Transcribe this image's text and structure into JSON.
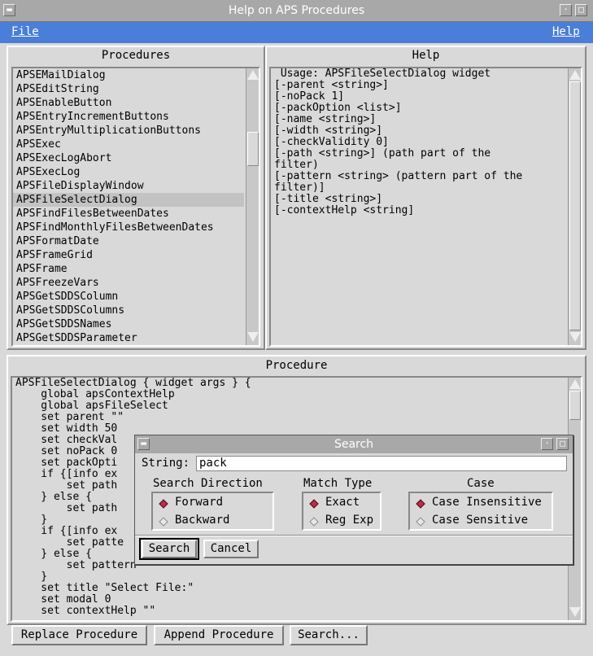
{
  "window": {
    "title": "Help on APS Procedures"
  },
  "menubar": {
    "file": "File",
    "help": "Help"
  },
  "procedures": {
    "title": "Procedures",
    "items": [
      "APSEMailDialog",
      "APSEditString",
      "APSEnableButton",
      "APSEntryIncrementButtons",
      "APSEntryMultiplicationButtons",
      "APSExec",
      "APSExecLogAbort",
      "APSExecLog",
      "APSFileDisplayWindow",
      "APSFileSelectDialog",
      "APSFindFilesBetweenDates",
      "APSFindMonthlyFilesBetweenDates",
      "APSFormatDate",
      "APSFrameGrid",
      "APSFrame",
      "APSFreezeVars",
      "APSGetSDDSColumn",
      "APSGetSDDSColumns",
      "APSGetSDDSNames",
      "APSGetSDDSParameter"
    ],
    "selected": "APSFileSelectDialog"
  },
  "help": {
    "title": "Help",
    "lines": [
      " Usage: APSFileSelectDialog widget",
      "[-parent <string>]",
      "[-noPack 1]",
      "[-packOption <list>]",
      "[-name <string>]",
      "[-width <string>]",
      "[-checkValidity 0]",
      "[-path <string>] (path part of the",
      "filter)",
      "[-pattern <string> (pattern part of the",
      "filter)]",
      "[-title <string>]",
      "[-contextHelp <string]"
    ]
  },
  "procedure": {
    "title": "Procedure",
    "lines": [
      "APSFileSelectDialog { widget args } {",
      "    global apsContextHelp",
      "    global apsFileSelect",
      "    set parent \"\"",
      "    set width 50",
      "    set checkVal",
      "    set noPack 0",
      "    set packOpti",
      "    if {[info ex",
      "        set path",
      "    } else {",
      "        set path",
      "    }",
      "    if {[info ex",
      "        set patte",
      "    } else {",
      "        set pattern \"*\"",
      "    }",
      "    set title \"Select File:\"",
      "    set modal 0",
      "    set contextHelp \"\""
    ]
  },
  "buttons": {
    "replace": "Replace Procedure",
    "append": "Append Procedure",
    "search": "Search..."
  },
  "search_dialog": {
    "title": "Search",
    "string_label": "String:",
    "string_value": "pack",
    "direction": {
      "label": "Search Direction",
      "options": [
        "Forward",
        "Backward"
      ],
      "selected": "Forward"
    },
    "match": {
      "label": "Match Type",
      "options": [
        "Exact",
        "Reg Exp"
      ],
      "selected": "Exact"
    },
    "case": {
      "label": "Case",
      "options": [
        "Case Insensitive",
        "Case Sensitive"
      ],
      "selected": "Case Insensitive"
    },
    "search_button": "Search",
    "cancel_button": "Cancel"
  },
  "colors": {
    "menubar": "#4a7ed8",
    "radio_on": "#b0305a",
    "selection": "#c3c3c3"
  }
}
